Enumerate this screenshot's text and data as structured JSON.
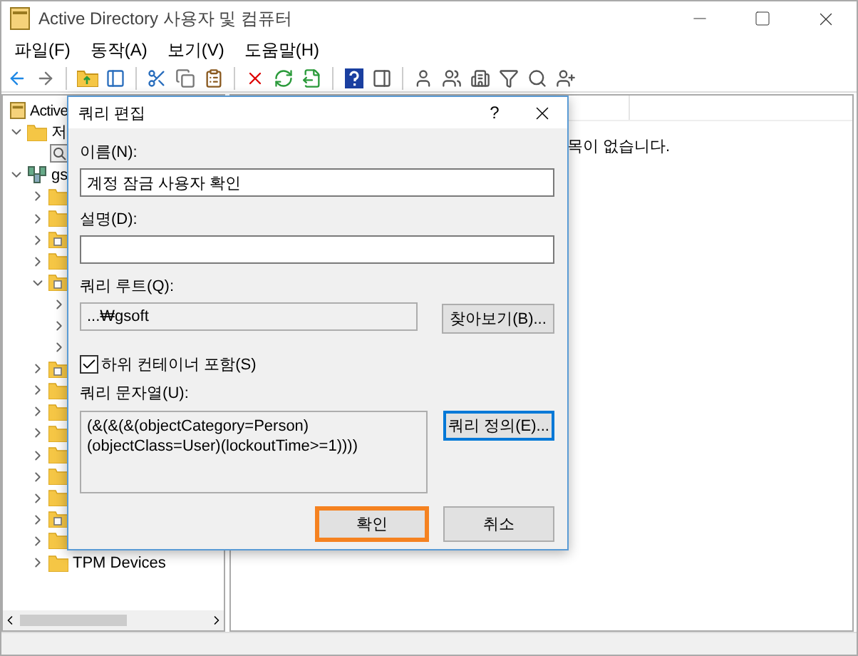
{
  "window": {
    "title": "Active Directory 사용자 및 컴퓨터"
  },
  "menu": [
    {
      "label": "파일(F)"
    },
    {
      "label": "동작(A)"
    },
    {
      "label": "보기(V)"
    },
    {
      "label": "도움말(H)"
    }
  ],
  "tree": [
    {
      "label": "Active",
      "kind": "root",
      "children": [
        {
          "label": "저",
          "kind": "folder",
          "expanded": true,
          "children": [
            {
              "kind": "query"
            }
          ]
        },
        {
          "label": "gs",
          "kind": "domain",
          "expanded": true,
          "children": [
            {
              "kind": "folder",
              "expanded": false
            },
            {
              "kind": "folder",
              "expanded": false
            },
            {
              "kind": "ou",
              "expanded": false
            },
            {
              "kind": "folder",
              "expanded": false
            },
            {
              "kind": "ou",
              "expanded": true,
              "children": [
                {
                  "expanded": false
                },
                {
                  "expanded": false
                },
                {
                  "expanded": false
                }
              ]
            },
            {
              "kind": "ou",
              "expanded": false
            },
            {
              "kind": "folder",
              "expanded": false
            },
            {
              "kind": "folder",
              "expanded": false
            },
            {
              "kind": "folder",
              "expanded": false
            },
            {
              "kind": "folder",
              "expanded": false
            },
            {
              "kind": "folder",
              "expanded": false
            },
            {
              "kind": "folder",
              "expanded": false
            },
            {
              "kind": "ou",
              "expanded": false
            },
            {
              "kind": "folder",
              "expanded": false
            },
            {
              "label": "TPM Devices",
              "kind": "folder",
              "expanded": false
            }
          ]
        }
      ]
    }
  ],
  "right_pane": {
    "message": "목이 없습니다."
  },
  "dialog": {
    "title": "쿼리 편집",
    "help": "?",
    "name": {
      "label": "이름(N):",
      "value": "계정 잠금 사용자 확인"
    },
    "description": {
      "label": "설명(D):"
    },
    "root": {
      "label": "쿼리 루트(Q):",
      "value": "...₩gsoft",
      "button": {
        "label": "찾아보기(B)...",
        "focused": false
      }
    },
    "subcontainers": {
      "label": "하위 컨테이너 포함(S)",
      "checked": true
    },
    "query": {
      "label": "쿼리 문자열(U):",
      "value": "(&(&(&(objectCategory=Person)(objectClass=User)(lockoutTime>=1))))",
      "button": {
        "label": "쿼리 정의(E)...",
        "focused": true
      }
    },
    "buttons": [
      {
        "label": "확인",
        "highlighted": true
      },
      {
        "label": "취소",
        "highlighted": false
      }
    ]
  }
}
